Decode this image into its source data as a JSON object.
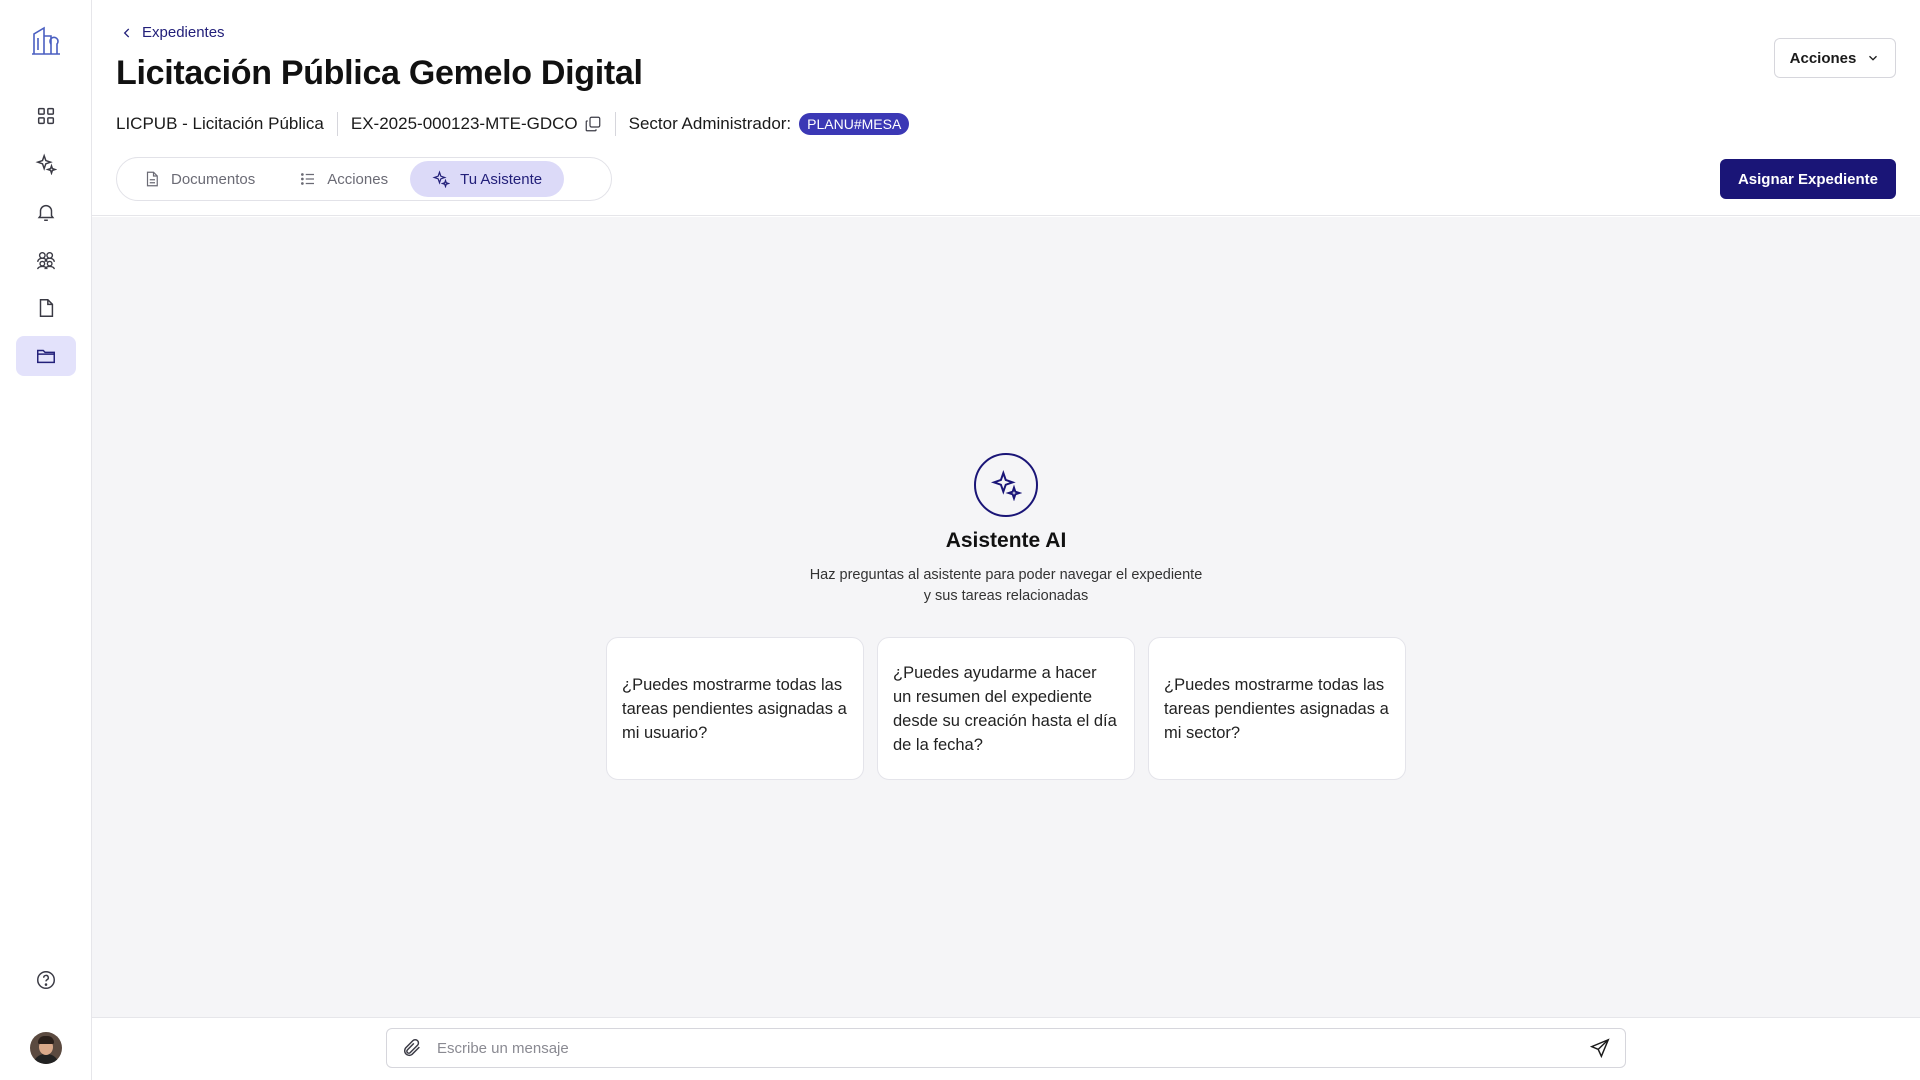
{
  "sidebar": {
    "items": [
      {
        "name": "dashboard",
        "icon": "grid-icon"
      },
      {
        "name": "assistant",
        "icon": "sparkles-icon"
      },
      {
        "name": "notifications",
        "icon": "bell-icon"
      },
      {
        "name": "teams",
        "icon": "users-icon"
      },
      {
        "name": "documents",
        "icon": "file-icon"
      },
      {
        "name": "expedientes",
        "icon": "folder-icon",
        "active": true
      }
    ]
  },
  "header": {
    "breadcrumb": "Expedientes",
    "title": "Licitación Pública Gemelo Digital",
    "type": "LICPUB - Licitación Pública",
    "code": "EX-2025-000123-MTE-GDCO",
    "sector_label": "Sector Administrador:",
    "sector_badge": "PLANU#MESA",
    "actions_label": "Acciones",
    "assign_label": "Asignar Expediente"
  },
  "tabs": [
    {
      "label": "Documentos",
      "icon": "document-icon",
      "active": false
    },
    {
      "label": "Acciones",
      "icon": "list-icon",
      "active": false
    },
    {
      "label": "Tu Asistente",
      "icon": "sparkles-icon",
      "active": true
    }
  ],
  "assistant": {
    "title": "Asistente AI",
    "subtitle": "Haz preguntas al asistente para poder navegar el expediente y sus tareas relacionadas",
    "suggestions": [
      "¿Puedes mostrarme todas las tareas pendientes asignadas a mi usuario?",
      "¿Puedes ayudarme a hacer un resumen del expediente desde su creación hasta el día de la fecha?",
      "¿Puedes mostrarme todas las tareas pendientes asignadas a mi sector?"
    ]
  },
  "composer": {
    "placeholder": "Escribe un mensaje"
  },
  "colors": {
    "accent": "#1a1577",
    "badge": "#3b38b5",
    "active_bg": "#e3e2fb",
    "canvas": "#f5f5f7"
  }
}
